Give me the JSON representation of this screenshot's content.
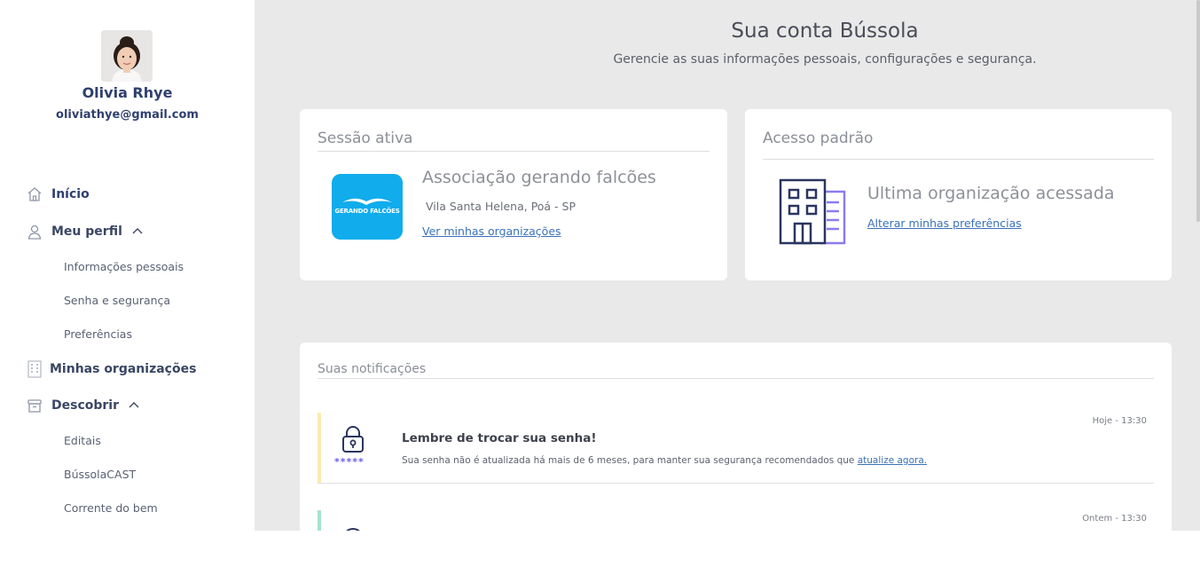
{
  "user": {
    "name": "Olivia Rhye",
    "email": "oliviathye@gmail.com"
  },
  "nav": {
    "inicio": "Início",
    "meu_perfil": "Meu perfil",
    "perfil_items": [
      "Informações pessoais",
      "Senha e segurança",
      "Preferências"
    ],
    "minhas_organizacoes": "Minhas organizações",
    "descobrir": "Descobrir",
    "descobrir_items": [
      "Editais",
      "BússolaCAST",
      "Corrente do bem"
    ]
  },
  "header": {
    "title": "Sua conta Bússola",
    "subtitle": "Gerencie as suas informações pessoais, configurações e segurança."
  },
  "session_card": {
    "title": "Sessão ativa",
    "logo_text": "GERANDO FALCÕES",
    "org_name": "Associação gerando falcões",
    "location": "Vila Santa Helena, Poá - SP",
    "link": "Ver minhas organizações"
  },
  "access_card": {
    "title": "Acesso padrão",
    "heading": "Ultima organização acessada",
    "link": "Alterar minhas preferências"
  },
  "notifications": {
    "title": "Suas notificações",
    "items": [
      {
        "time": "Hoje - 13:30",
        "title": "Lembre de trocar sua senha!",
        "body": "Sua senha não é atualizada há mais de 6 meses, para manter sua segurança recomendados que ",
        "link": "atualize agora.",
        "accent": "#fbeab0",
        "password_glyph": "*****"
      },
      {
        "time": "Ontem - 13:30",
        "accent": "#a8e2cf"
      }
    ]
  },
  "colors": {
    "brand_navy": "#2f3f6f",
    "logo_blue": "#10acec",
    "background": "#e9e9e9",
    "link": "#3a72b8"
  }
}
